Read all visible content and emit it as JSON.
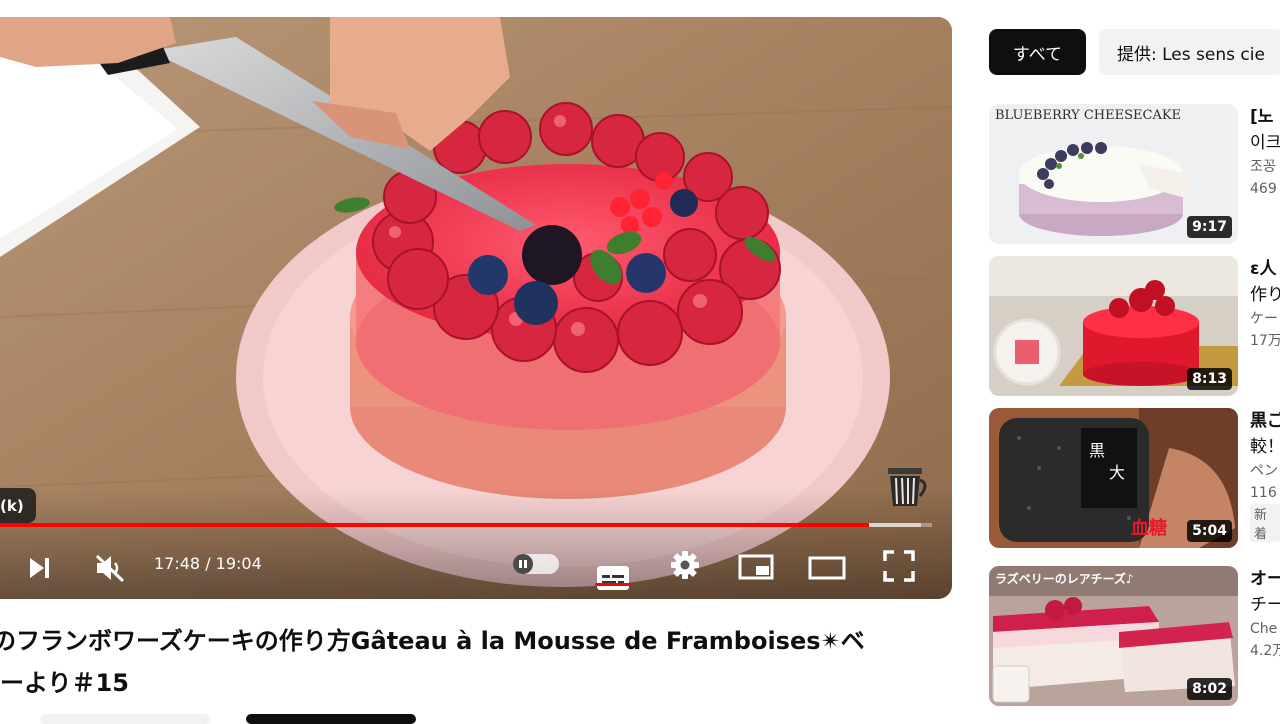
{
  "player": {
    "chapter_label": "(k)",
    "time_text": "17:48 / 19:04",
    "progress": {
      "played_fraction": 0.932,
      "buffered_fraction": 0.988
    },
    "icons": {
      "next": "next-track-icon",
      "mute": "muted-speaker-icon",
      "autoplay": "autoplay-toggle-icon",
      "subtitles": "subtitles-icon",
      "settings": "gear-icon",
      "miniplayer": "miniplayer-icon",
      "theater": "theater-mode-icon",
      "fullscreen": "fullscreen-icon"
    },
    "accent_color": "#ff0000"
  },
  "video": {
    "title_line1": "のフランボワーズケーキの作り方Gâteau à la Mousse de Framboises✴ベ",
    "title_line2": "ーより＃15"
  },
  "chips": [
    {
      "label": "すべて",
      "active": true
    },
    {
      "label": "提供: Les sens cie",
      "active": false
    }
  ],
  "recommendations": [
    {
      "thumb_text": "BLUEBERRY CHEESECAKE",
      "duration": "9:17",
      "line1": "[노",
      "line2": "이크",
      "channel": "조꽁",
      "meta": "469"
    },
    {
      "thumb_text": "",
      "duration": "8:13",
      "line1": "ε人",
      "line2": "作り",
      "channel": "ケー",
      "meta": "17万"
    },
    {
      "thumb_text": "血糖",
      "duration": "5:04",
      "line1": "黒ご",
      "line2": "較！",
      "channel": "ペン",
      "meta": "116",
      "badge": "新着"
    },
    {
      "thumb_text": "ラズベリーのレアチーズ♪",
      "duration": "8:02",
      "line1": "オー",
      "line2": "チー",
      "channel": "Che",
      "meta": "4.2万"
    }
  ]
}
